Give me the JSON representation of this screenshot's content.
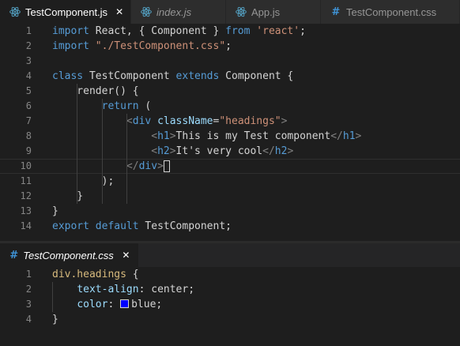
{
  "top_tabs": [
    {
      "label": "TestComponent.js",
      "icon": "react-icon",
      "active": true,
      "italic": false,
      "close": "✕"
    },
    {
      "label": "index.js",
      "icon": "react-icon",
      "active": false,
      "italic": true
    },
    {
      "label": "App.js",
      "icon": "react-icon",
      "active": false,
      "italic": false
    },
    {
      "label": "TestComponent.css",
      "icon": "css-hash-icon",
      "icon_glyph": "#",
      "active": false,
      "italic": false
    }
  ],
  "bottom_tabs": [
    {
      "label": "TestComponent.css",
      "icon": "css-hash-icon",
      "icon_glyph": "#",
      "active": true,
      "italic": true,
      "close": "✕"
    }
  ],
  "top_editor": {
    "current_line": 10,
    "lines": [
      {
        "n": "1",
        "tokens": [
          [
            "kw",
            "import"
          ],
          [
            "p",
            " React, { Component } "
          ],
          [
            "kw",
            "from"
          ],
          [
            "p",
            " "
          ],
          [
            "str",
            "'react'"
          ],
          [
            "p",
            ";"
          ]
        ]
      },
      {
        "n": "2",
        "tokens": [
          [
            "kw",
            "import"
          ],
          [
            "p",
            " "
          ],
          [
            "str",
            "\"./TestComponent.css\""
          ],
          [
            "p",
            ";"
          ]
        ]
      },
      {
        "n": "3",
        "tokens": []
      },
      {
        "n": "4",
        "tokens": [
          [
            "kw",
            "class"
          ],
          [
            "p",
            " TestComponent "
          ],
          [
            "kw",
            "extends"
          ],
          [
            "p",
            " Component {"
          ]
        ]
      },
      {
        "n": "5",
        "tokens": [
          [
            "p",
            "    render() {"
          ]
        ]
      },
      {
        "n": "6",
        "tokens": [
          [
            "p",
            "        "
          ],
          [
            "kw",
            "return"
          ],
          [
            "p",
            " ("
          ]
        ]
      },
      {
        "n": "7",
        "tokens": [
          [
            "p",
            "            "
          ],
          [
            "br",
            "<"
          ],
          [
            "tag",
            "div"
          ],
          [
            "p",
            " "
          ],
          [
            "attr",
            "className"
          ],
          [
            "p",
            "="
          ],
          [
            "str",
            "\"headings\""
          ],
          [
            "br",
            ">"
          ]
        ]
      },
      {
        "n": "8",
        "tokens": [
          [
            "p",
            "                "
          ],
          [
            "br",
            "<"
          ],
          [
            "tag",
            "h1"
          ],
          [
            "br",
            ">"
          ],
          [
            "p",
            "This is my Test component"
          ],
          [
            "br",
            "</"
          ],
          [
            "tag",
            "h1"
          ],
          [
            "br",
            ">"
          ]
        ]
      },
      {
        "n": "9",
        "tokens": [
          [
            "p",
            "                "
          ],
          [
            "br",
            "<"
          ],
          [
            "tag",
            "h2"
          ],
          [
            "br",
            ">"
          ],
          [
            "p",
            "It's very cool"
          ],
          [
            "br",
            "</"
          ],
          [
            "tag",
            "h2"
          ],
          [
            "br",
            ">"
          ]
        ]
      },
      {
        "n": "10",
        "tokens": [
          [
            "p",
            "            "
          ],
          [
            "br",
            "</"
          ],
          [
            "tag",
            "div"
          ],
          [
            "br",
            ">"
          ]
        ]
      },
      {
        "n": "11",
        "tokens": [
          [
            "p",
            "        );"
          ]
        ]
      },
      {
        "n": "12",
        "tokens": [
          [
            "p",
            "    }"
          ]
        ]
      },
      {
        "n": "13",
        "tokens": [
          [
            "p",
            "}"
          ]
        ]
      },
      {
        "n": "14",
        "tokens": [
          [
            "kw",
            "export"
          ],
          [
            "p",
            " "
          ],
          [
            "kw",
            "default"
          ],
          [
            "p",
            " TestComponent;"
          ]
        ]
      }
    ]
  },
  "bottom_editor": {
    "swatch_color": "#0000ff",
    "lines": [
      {
        "n": "1",
        "tokens": [
          [
            "sel",
            "div.headings"
          ],
          [
            "p",
            " {"
          ]
        ]
      },
      {
        "n": "2",
        "tokens": [
          [
            "p",
            "    "
          ],
          [
            "prop",
            "text-align"
          ],
          [
            "p",
            ": center;"
          ]
        ]
      },
      {
        "n": "3",
        "tokens": [
          [
            "p",
            "    "
          ],
          [
            "prop",
            "color"
          ],
          [
            "p",
            ": "
          ],
          [
            "swatch",
            ""
          ],
          [
            "p",
            "blue;"
          ]
        ]
      },
      {
        "n": "4",
        "tokens": [
          [
            "p",
            "}"
          ]
        ]
      }
    ]
  },
  "colors": {
    "background": "#1e1e1e",
    "tabbar": "#252526",
    "keyword": "#569cd6",
    "string": "#ce9178",
    "attribute": "#9cdcfe",
    "selector": "#d7ba7d",
    "react": "#519aba",
    "css": "#3f94d7"
  }
}
